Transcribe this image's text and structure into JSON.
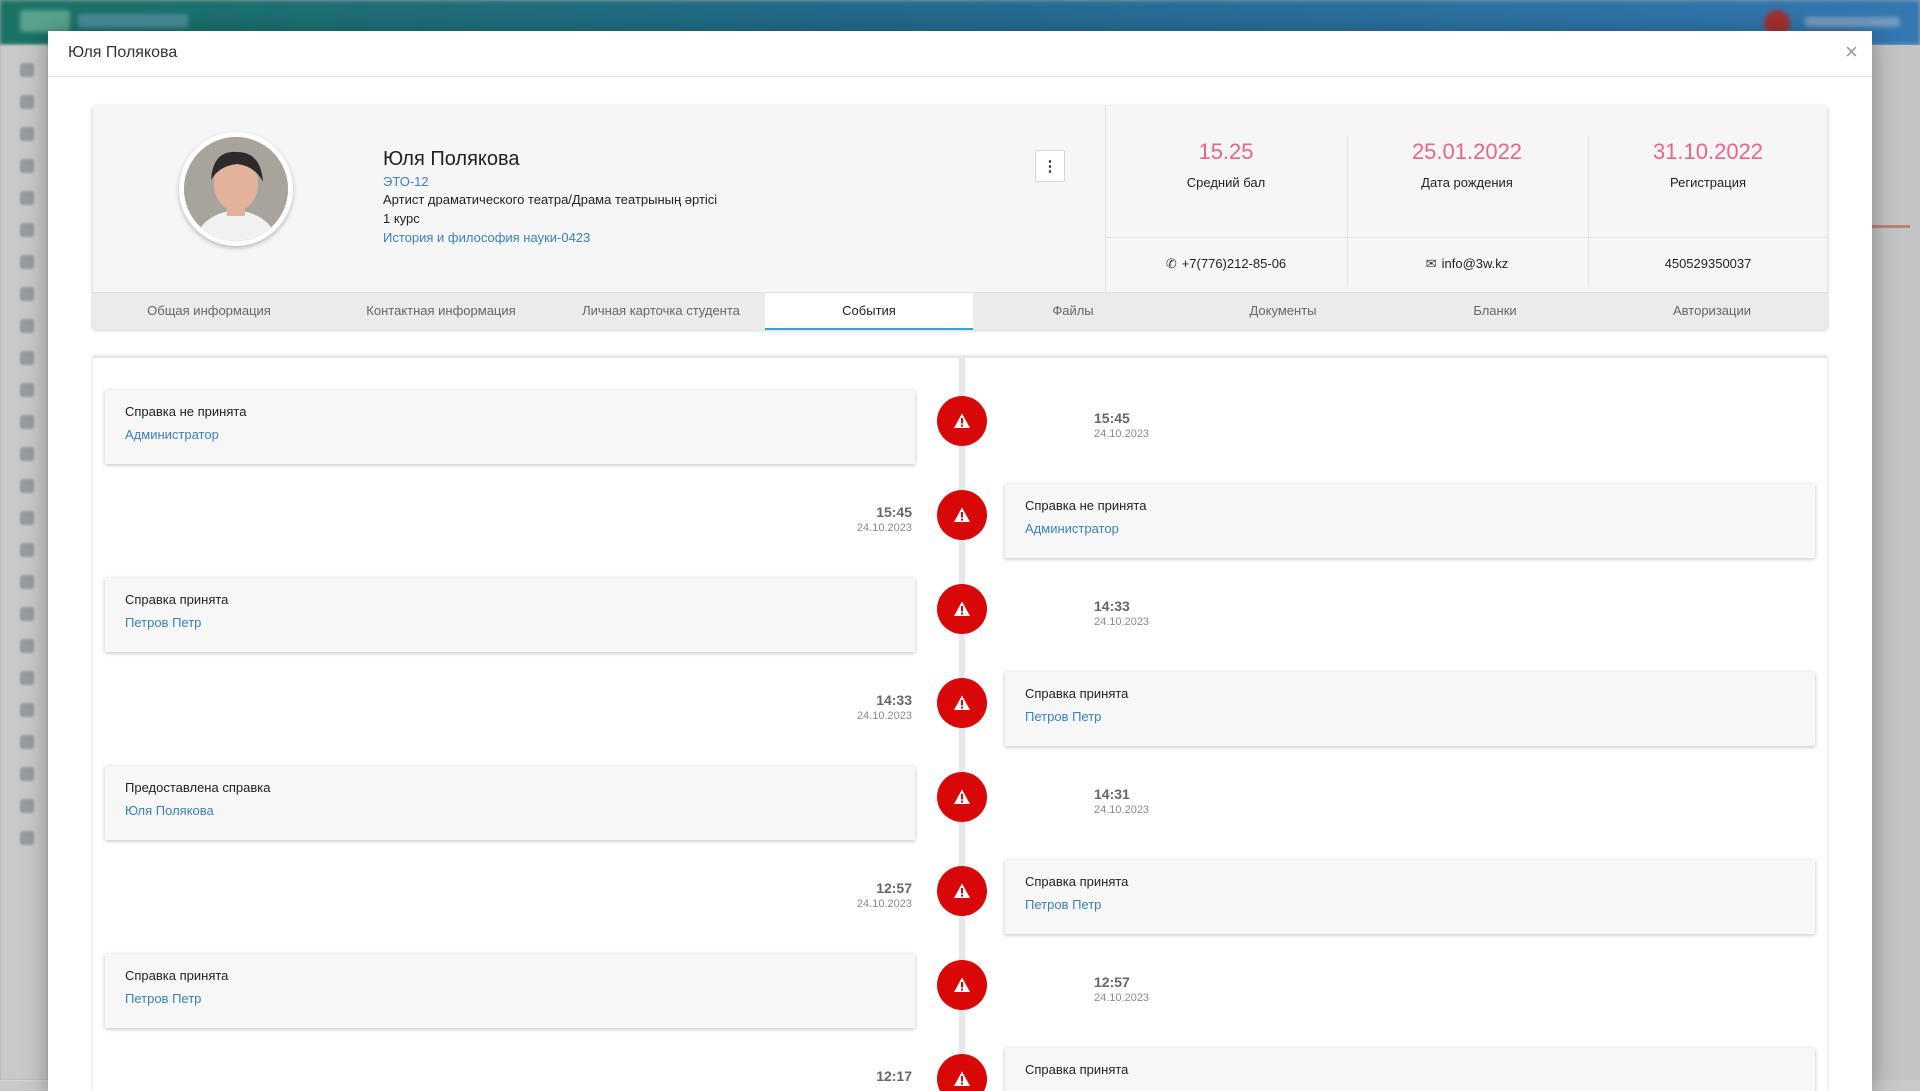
{
  "modal": {
    "title": "Юля Полякова",
    "close": "×"
  },
  "profile": {
    "name": "Юля Полякова",
    "group": "ЭТО-12",
    "specialty": "Артист драматического театра/Драма театрының әртісі",
    "course": "1 курс",
    "department": "История и философия науки-0423",
    "menu": "⋮",
    "stats": [
      {
        "value": "15.25",
        "label": "Средний бал"
      },
      {
        "value": "25.01.2022",
        "label": "Дата рождения"
      },
      {
        "value": "31.10.2022",
        "label": "Регистрация"
      }
    ],
    "phone": "+7(776)212-85-06",
    "email": "info@3w.kz",
    "iin": "450529350037",
    "accent": "#e9638a"
  },
  "tabs": [
    {
      "label": "Общая информация"
    },
    {
      "label": "Контактная информация"
    },
    {
      "label": "Личная карточка студента"
    },
    {
      "label": "События"
    },
    {
      "label": "Файлы"
    },
    {
      "label": "Документы"
    },
    {
      "label": "Бланки"
    },
    {
      "label": "Авторизации"
    }
  ],
  "active_tab": "События",
  "events": [
    {
      "title": "Справка не принята",
      "user": "Администратор",
      "time": "15:45",
      "date": "24.10.2023",
      "side": "left",
      "icon": "warning-icon"
    },
    {
      "title": "Справка не принята",
      "user": "Администратор",
      "time": "15:45",
      "date": "24.10.2023",
      "side": "right",
      "icon": "warning-icon"
    },
    {
      "title": "Справка принята",
      "user": "Петров Петр",
      "time": "14:33",
      "date": "24.10.2023",
      "side": "left",
      "icon": "warning-icon"
    },
    {
      "title": "Справка принята",
      "user": "Петров Петр",
      "time": "14:33",
      "date": "24.10.2023",
      "side": "right",
      "icon": "warning-icon"
    },
    {
      "title": "Предоставлена справка",
      "user": "Юля Полякова",
      "time": "14:31",
      "date": "24.10.2023",
      "side": "left",
      "icon": "warning-icon"
    },
    {
      "title": "Справка принята",
      "user": "Петров Петр",
      "time": "12:57",
      "date": "24.10.2023",
      "side": "right",
      "icon": "warning-icon"
    },
    {
      "title": "Справка принята",
      "user": "Петров Петр",
      "time": "12:57",
      "date": "24.10.2023",
      "side": "left",
      "icon": "warning-icon"
    },
    {
      "title": "Справка принята",
      "user": "",
      "time": "12:17",
      "date": "",
      "side": "right",
      "icon": "warning-icon"
    }
  ],
  "colors": {
    "event_icon": "#d90808",
    "link": "#3a7fc1",
    "tab_active_border": "#29a8dc"
  }
}
